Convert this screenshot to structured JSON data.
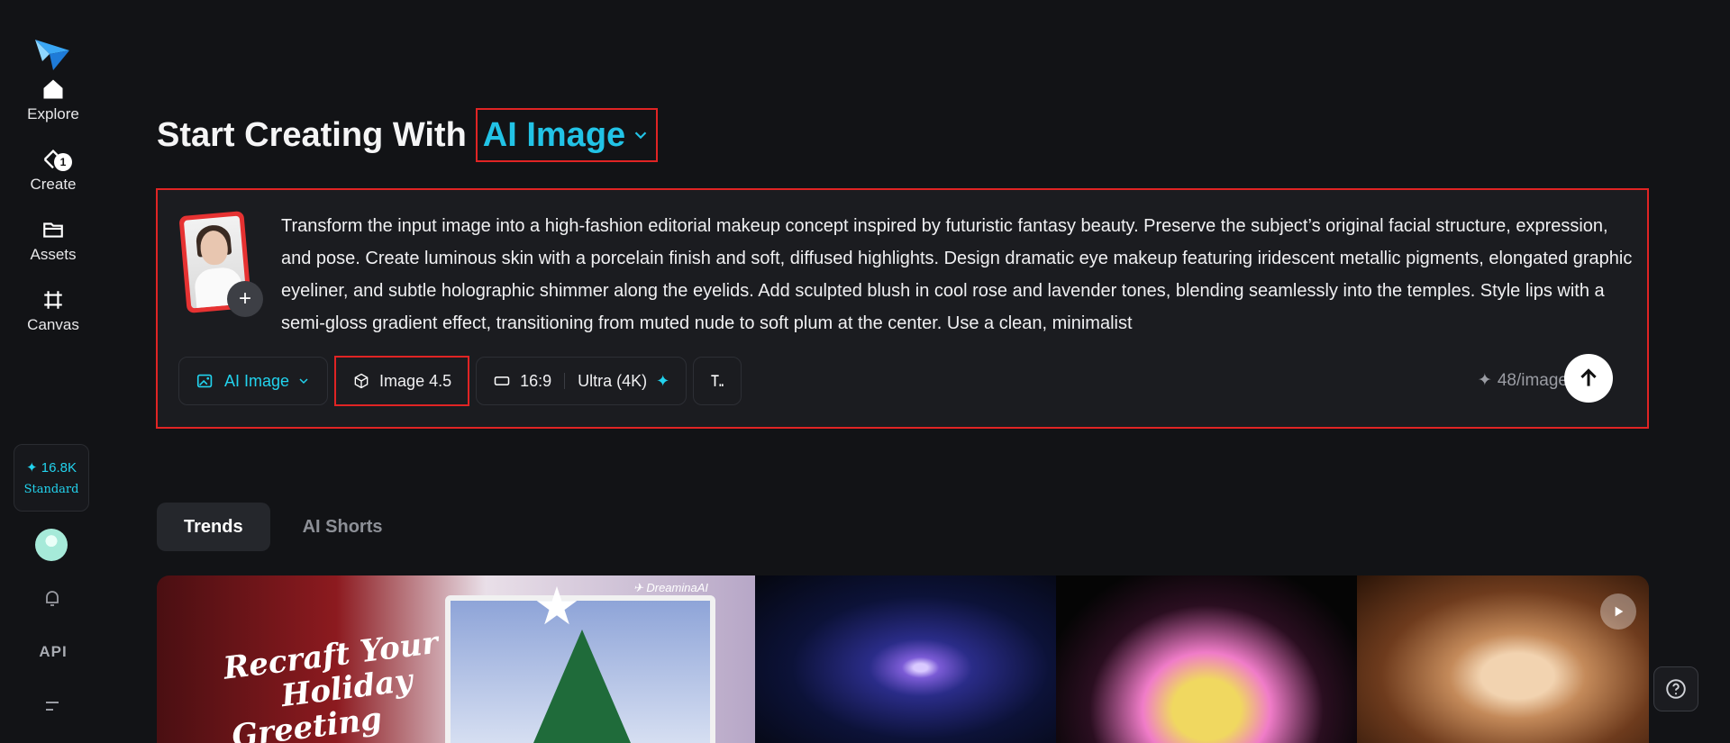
{
  "sidebar": {
    "items": [
      {
        "label": "Explore",
        "icon": "home-icon"
      },
      {
        "label": "Create",
        "icon": "create-icon",
        "badge": "1"
      },
      {
        "label": "Assets",
        "icon": "folder-icon"
      },
      {
        "label": "Canvas",
        "icon": "canvas-icon"
      }
    ],
    "credits": {
      "amount": "16.8K",
      "plan": "Standard"
    },
    "api_label": "API"
  },
  "heading": {
    "prefix": "Start Creating With",
    "mode": "AI Image"
  },
  "composer": {
    "prompt": "Transform the input image into a high-fashion editorial makeup concept inspired by futuristic fantasy beauty. Preserve the subject’s original facial structure, expression, and pose. Create luminous skin with a porcelain finish and soft, diffused highlights. Design dramatic eye makeup featuring iridescent metallic pigments, elongated graphic eyeliner, and subtle holographic shimmer along the eyelids. Add sculpted blush in cool rose and lavender tones, blending seamlessly into the temples. Style lips with a semi-gloss gradient effect, transitioning from muted nude to soft plum at the center. Use a clean, minimalist",
    "add_label": "+",
    "toolbar": {
      "mode": "AI Image",
      "model": "Image 4.5",
      "ratio": "16:9",
      "quality": "Ultra (4K)"
    },
    "cost": "48/image"
  },
  "tabs": [
    {
      "label": "Trends",
      "active": true
    },
    {
      "label": "AI Shorts",
      "active": false
    }
  ],
  "gallery": {
    "card1_title_lines": [
      "Recraft Your",
      "Holiday",
      "Greeting"
    ],
    "card1_watermark": "DreaminaAI"
  },
  "colors": {
    "accent": "#22d3ee",
    "highlight_border": "#e02424",
    "background": "#121316"
  }
}
